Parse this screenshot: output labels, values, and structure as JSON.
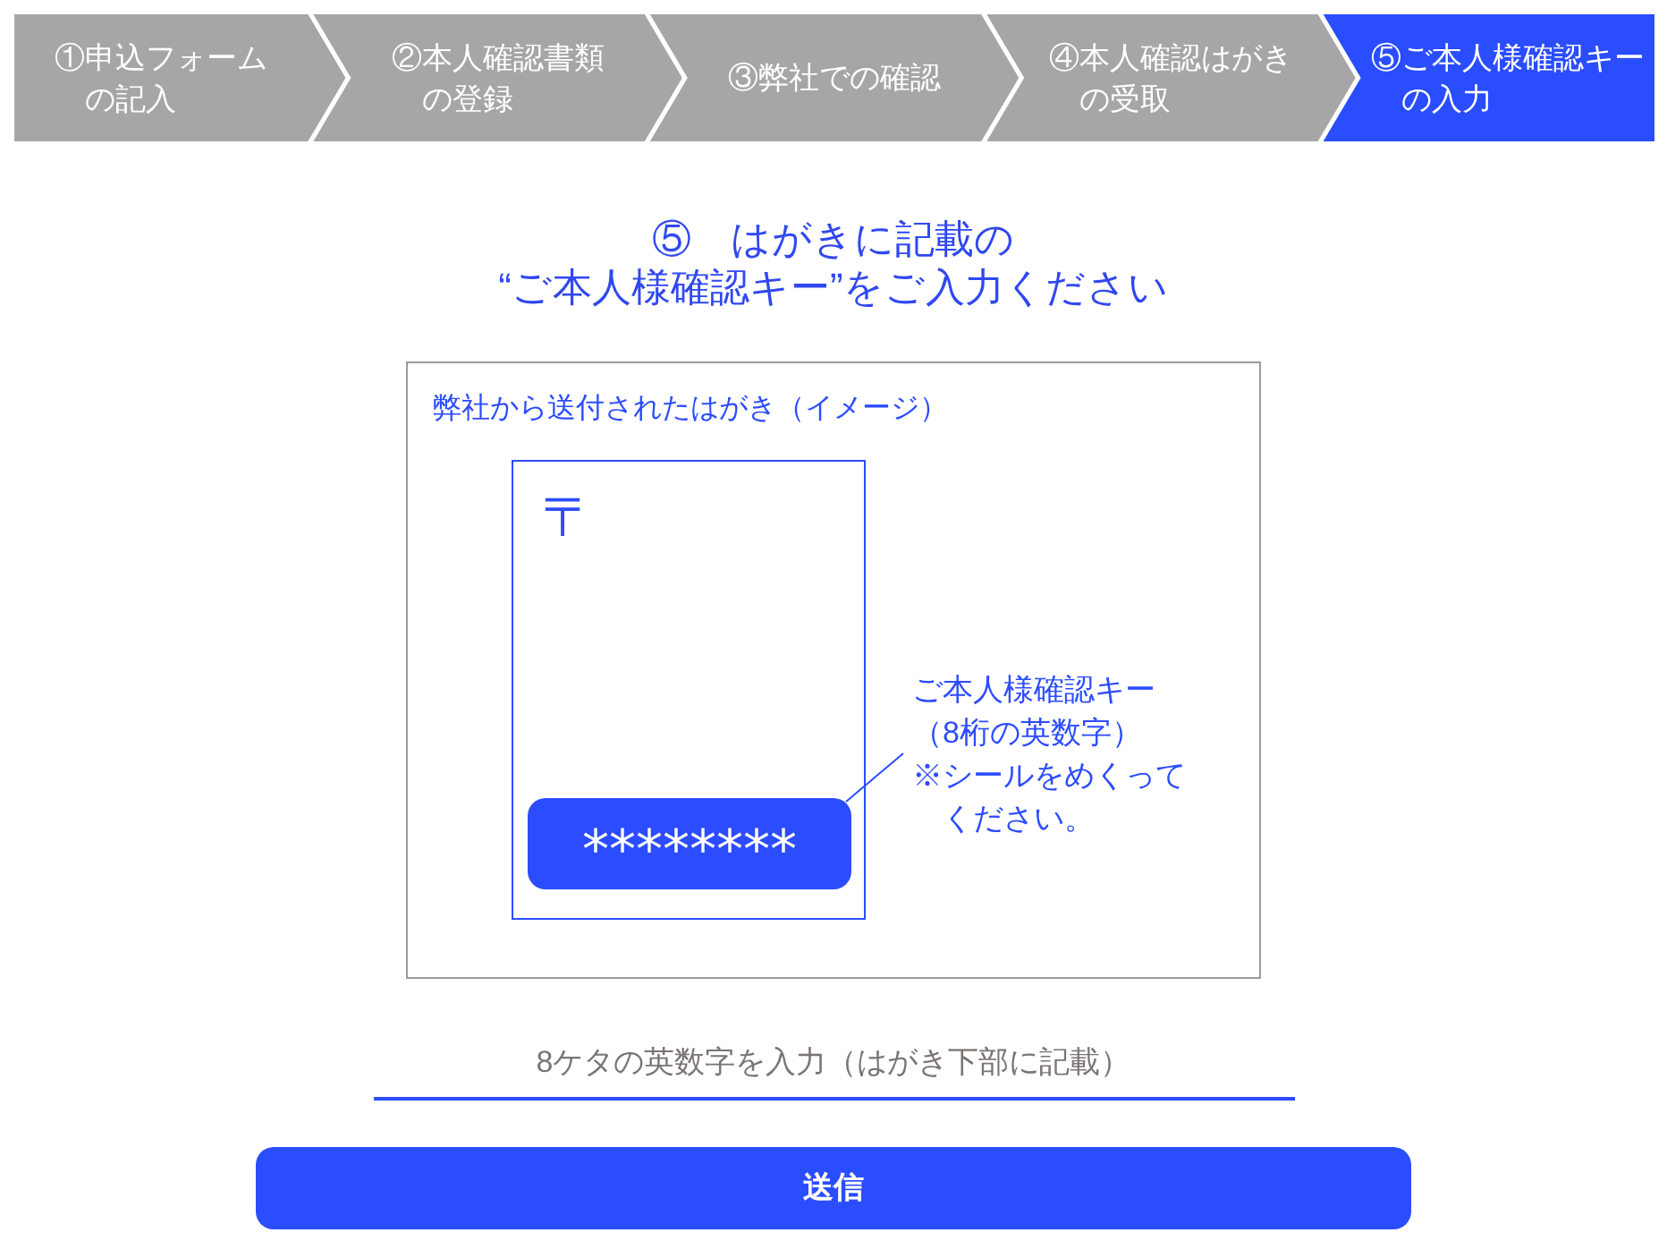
{
  "steps": [
    {
      "lines": [
        "①申込フォーム",
        "の記入"
      ],
      "selected": false
    },
    {
      "lines": [
        "②本人確認書類",
        "の登録"
      ],
      "selected": false
    },
    {
      "lines": [
        "③弊社での確認"
      ],
      "selected": false
    },
    {
      "lines": [
        "④本人確認はがき",
        "の受取"
      ],
      "selected": false
    },
    {
      "lines": [
        "⑤ご本人様確認キー",
        "の入力"
      ],
      "selected": true
    }
  ],
  "heading": {
    "lines": [
      "⑤　はがきに記載の",
      "“ご本人様確認キー”をご入力ください"
    ]
  },
  "postcard_image": {
    "caption": "弊社から送付されたはがき（イメージ）",
    "postal_mark": "〒",
    "key_mask": "********",
    "note_lines": [
      "ご本人様確認キー",
      "（8桁の英数字）",
      "※シールをめくって",
      "　ください。"
    ]
  },
  "key_field": {
    "placeholder": "8ケタの英数字を入力（はがき下部に記載）"
  },
  "submit_button": {
    "label": "送信"
  }
}
